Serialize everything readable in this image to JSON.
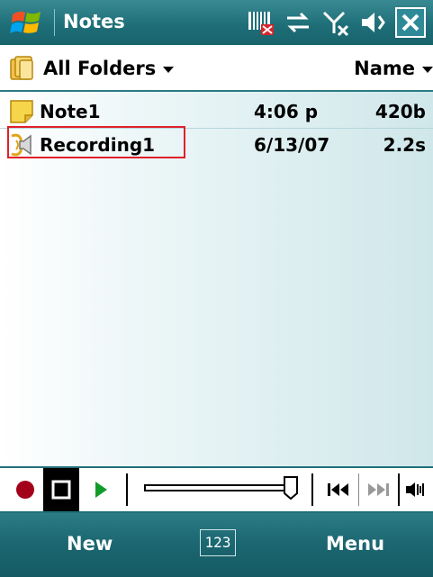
{
  "app": {
    "title": "Notes"
  },
  "status": {
    "icons": [
      "signal-off-icon",
      "sync-icon",
      "antenna-off-icon",
      "volume-icon",
      "close-icon"
    ]
  },
  "folderbar": {
    "folder_label": "All Folders",
    "sort_label": "Name"
  },
  "notes": [
    {
      "name": "Note1",
      "date": "4:06 p",
      "size": "420b",
      "icon": "note-icon"
    },
    {
      "name": "Recording1",
      "date": "6/13/07",
      "size": "2.2s",
      "icon": "speaker-icon",
      "focused": true
    }
  ],
  "recorder": {
    "position": 1.0,
    "buttons": [
      "record-icon",
      "stop-icon",
      "play-icon",
      "previous-icon",
      "next-icon",
      "volume-icon"
    ]
  },
  "softkeys": {
    "left": "New",
    "center": "123",
    "right": "Menu"
  },
  "colors": {
    "accent": "#1f6f78",
    "focus": "#e0202a",
    "record": "#a3001a",
    "play": "#119b2b"
  }
}
